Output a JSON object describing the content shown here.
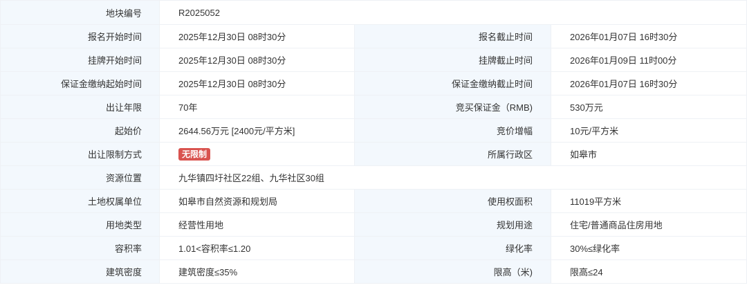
{
  "rows": [
    {
      "l1": "地块编号",
      "v1": "R2025052",
      "l2": "",
      "v2": "",
      "span": true
    },
    {
      "l1": "报名开始时间",
      "v1": "2025年12月30日 08时30分",
      "l2": "报名截止时间",
      "v2": "2026年01月07日 16时30分"
    },
    {
      "l1": "挂牌开始时间",
      "v1": "2025年12月30日 08时30分",
      "l2": "挂牌截止时间",
      "v2": "2026年01月09日 11时00分"
    },
    {
      "l1": "保证金缴纳起始时间",
      "v1": "2025年12月30日 08时30分",
      "l2": "保证金缴纳截止时间",
      "v2": "2026年01月07日 16时30分"
    },
    {
      "l1": "出让年限",
      "v1": "70年",
      "l2": "竞买保证金（RMB)",
      "v2": "530万元"
    },
    {
      "l1": "起始价",
      "v1": "2644.56万元 [2400元/平方米]",
      "l2": "竞价增幅",
      "v2": "10元/平方米"
    },
    {
      "l1": "出让限制方式",
      "v1": "无限制",
      "l2": "所属行政区",
      "v2": "如皋市",
      "badge": true
    },
    {
      "l1": "资源位置",
      "v1": "九华镇四圩社区22组、九华社区30组",
      "l2": "",
      "v2": "",
      "span": true
    },
    {
      "l1": "土地权属单位",
      "v1": "如皋市自然资源和规划局",
      "l2": "使用权面积",
      "v2": "11019平方米"
    },
    {
      "l1": "用地类型",
      "v1": "经营性用地",
      "l2": "规划用途",
      "v2": "住宅/普通商品住房用地"
    },
    {
      "l1": "容积率",
      "v1": "1.01<容积率≤1.20",
      "l2": "绿化率",
      "v2": "30%≤绿化率"
    },
    {
      "l1": "建筑密度",
      "v1": "建筑密度≤35%",
      "l2": "限高（米)",
      "v2": "限高≤24"
    }
  ],
  "colors": {
    "label_bg": "#f3f8fd",
    "border": "#eef1f5",
    "badge_bg": "#d9534f"
  }
}
